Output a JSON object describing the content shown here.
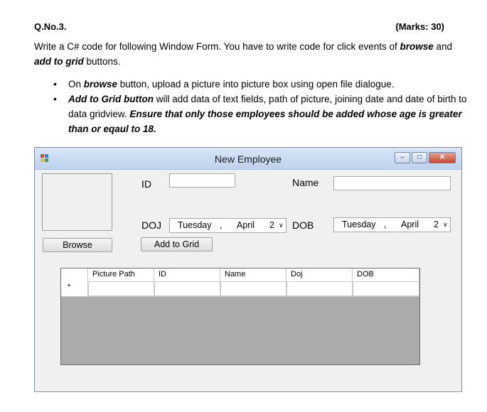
{
  "question": {
    "number": "Q.No.3.",
    "marks": "(Marks: 30)",
    "intro": {
      "t1": "Write a C# code for following Window Form. You have to write code for click events of ",
      "browse": "browse",
      "t2": " and ",
      "add_to_grid": "add to grid",
      "t3": " buttons."
    },
    "bullets": [
      {
        "t1": "On ",
        "browse": "browse",
        "t2": " button, upload a picture into picture box  using open file dialogue."
      },
      {
        "add_to_grid_button": "Add to Grid button",
        "t2": " will add data of text fields, path of picture, joining date and date of birth to data gridview. ",
        "ensure": "Ensure that only those employees should be added whose age is greater than or eqaul to 18."
      }
    ]
  },
  "window": {
    "title": "New Employee",
    "controls": {
      "minimize": "–",
      "maximize": "□",
      "close": "✕"
    }
  },
  "form": {
    "browse_button": "Browse",
    "add_to_grid_button": "Add to Grid",
    "id_label": "ID",
    "name_label": "Name",
    "doj_label": "DOJ",
    "dob_label": "DOB",
    "doj_picker": {
      "day": "Tuesday",
      "sep": ",",
      "month": "April",
      "date": "2"
    },
    "dob_picker": {
      "day": "Tuesday",
      "sep": ",",
      "month": "April",
      "date": "2"
    }
  },
  "grid": {
    "columns": [
      "Picture Path",
      "ID",
      "Name",
      "Doj",
      "DOB"
    ],
    "new_row_marker": "*"
  }
}
